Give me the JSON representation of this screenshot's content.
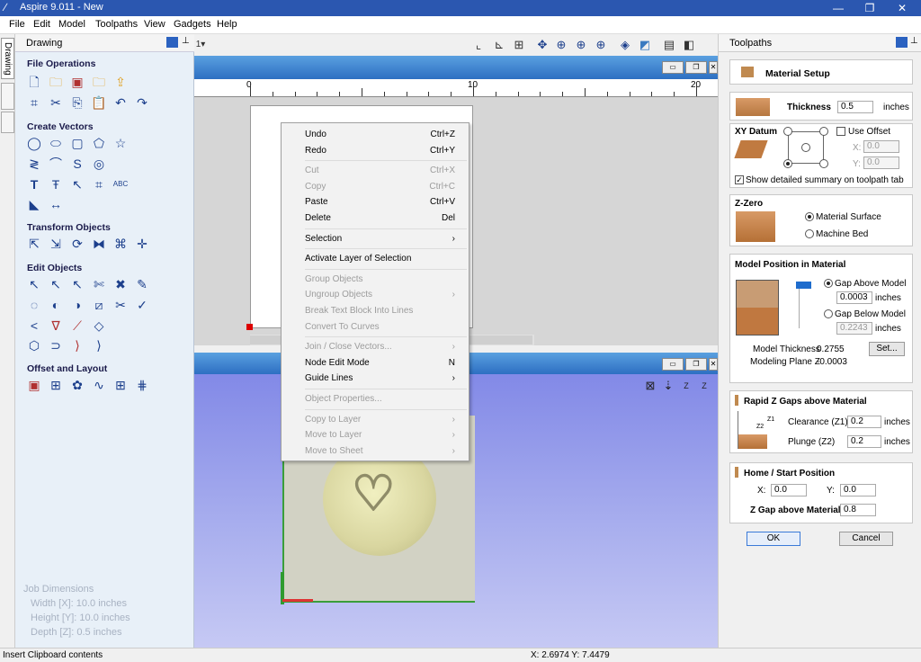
{
  "window": {
    "title": "Aspire 9.011 - New"
  },
  "menu": [
    "File",
    "Edit",
    "Model",
    "Toolpaths",
    "View",
    "Gadgets",
    "Help"
  ],
  "left_panel": {
    "side_tab": "Drawing",
    "header": "Drawing",
    "sections": {
      "file_operations": "File Operations",
      "create_vectors": "Create Vectors",
      "transform_objects": "Transform Objects",
      "edit_objects": "Edit Objects",
      "offset_and_layout": "Offset and Layout"
    },
    "job_dimensions": {
      "title": "Job Dimensions",
      "width": "Width  [X]: 10.0 inches",
      "height": "Height [Y]: 10.0 inches",
      "depth": "Depth  [Z]: 0.5 inches"
    }
  },
  "ruler": {
    "labels": [
      "0",
      "10",
      "20"
    ]
  },
  "context_menu": {
    "items": [
      {
        "label": "Undo",
        "shortcut": "Ctrl+Z",
        "disabled": false
      },
      {
        "label": "Redo",
        "shortcut": "Ctrl+Y",
        "disabled": false
      },
      {
        "label": "Cut",
        "shortcut": "Ctrl+X",
        "disabled": true
      },
      {
        "label": "Copy",
        "shortcut": "Ctrl+C",
        "disabled": true
      },
      {
        "label": "Paste",
        "shortcut": "Ctrl+V",
        "disabled": false
      },
      {
        "label": "Delete",
        "shortcut": "Del",
        "disabled": false
      },
      {
        "label": "Selection",
        "shortcut": "›",
        "disabled": false
      },
      {
        "label": "Activate Layer of Selection",
        "shortcut": "",
        "disabled": false
      },
      {
        "label": "Group Objects",
        "shortcut": "",
        "disabled": true
      },
      {
        "label": "Ungroup Objects",
        "shortcut": "›",
        "disabled": true
      },
      {
        "label": "Break Text Block Into Lines",
        "shortcut": "",
        "disabled": true
      },
      {
        "label": "Convert To Curves",
        "shortcut": "",
        "disabled": true
      },
      {
        "label": "Join / Close Vectors...",
        "shortcut": "›",
        "disabled": true
      },
      {
        "label": "Node Edit Mode",
        "shortcut": "N",
        "disabled": false
      },
      {
        "label": "Guide Lines",
        "shortcut": "›",
        "disabled": false
      },
      {
        "label": "Object Properties...",
        "shortcut": "",
        "disabled": true
      },
      {
        "label": "Copy to Layer",
        "shortcut": "›",
        "disabled": true
      },
      {
        "label": "Move to Layer",
        "shortcut": "›",
        "disabled": true
      },
      {
        "label": "Move to Sheet",
        "shortcut": "›",
        "disabled": true
      }
    ]
  },
  "right_panel": {
    "header": "Toolpaths",
    "material_setup": "Material Setup",
    "thickness": {
      "label": "Thickness",
      "value": "0.5",
      "unit": "inches"
    },
    "xy_datum": {
      "title": "XY Datum",
      "use_offset": "Use Offset",
      "x_label": "X:",
      "x_value": "0.0",
      "y_label": "Y:",
      "y_value": "0.0",
      "show_summary": "Show detailed summary on toolpath tab"
    },
    "z_zero": {
      "title": "Z-Zero",
      "option1": "Material Surface",
      "option2": "Machine Bed"
    },
    "model_position": {
      "title": "Model Position in Material",
      "gap_above": "Gap Above Model",
      "gap_above_value": "0.0003",
      "unit": "inches",
      "gap_below": "Gap Below Model",
      "gap_below_value": "0.2243",
      "model_thickness_label": "Model Thickness",
      "model_thickness_value": "0.2755",
      "modeling_plane_label": "Modeling Plane Z",
      "modeling_plane_value": "-0.0003",
      "set_button": "Set..."
    },
    "rapid_z": {
      "title": "Rapid Z Gaps above Material",
      "clearance_label": "Clearance (Z1)",
      "clearance_value": "0.2",
      "plunge_label": "Plunge (Z2)",
      "plunge_value": "0.2",
      "unit": "inches",
      "z1": "Z1",
      "z2": "Z2"
    },
    "home": {
      "title": "Home / Start Position",
      "x_label": "X:",
      "x_value": "0.0",
      "y_label": "Y:",
      "y_value": "0.0",
      "zgap_label": "Z Gap above Material",
      "zgap_value": "0.8"
    },
    "ok": "OK",
    "cancel": "Cancel"
  },
  "status": {
    "left": "Insert Clipboard contents",
    "coords": "X: 2.6974 Y: 7.4479"
  }
}
